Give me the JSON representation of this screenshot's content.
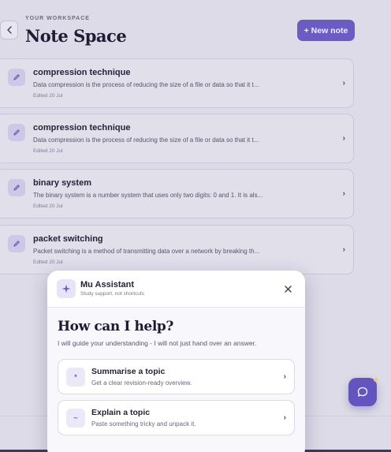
{
  "header": {
    "workspace_label": "YOUR WORKSPACE",
    "title": "Note Space",
    "new_note_label": "+ New note",
    "back_icon": "chevron-left-icon"
  },
  "notes": [
    {
      "title": "compression technique",
      "snippet": "Data compression is the process of reducing the size of a file or data so that it t...",
      "edited": "Edited 20 Jul"
    },
    {
      "title": "compression technique",
      "snippet": "Data compression is the process of reducing the size of a file or data so that it t...",
      "edited": "Edited 20 Jul"
    },
    {
      "title": "binary system",
      "snippet": "The binary system is a number system that uses only two digits: 0 and 1. It is als...",
      "edited": "Edited 20 Jul"
    },
    {
      "title": "packet switching",
      "snippet": "Packet switching is a method of transmitting data over a network by breaking th...",
      "edited": "Edited 20 Jul"
    }
  ],
  "assistant": {
    "name": "Mu Assistant",
    "tagline": "Study support, not shortcuts",
    "heading": "How can I help?",
    "intro": "I will guide your understanding - I will not just hand over an answer.",
    "options": [
      {
        "icon_glyph": "*",
        "title": "Summarise a topic",
        "description": "Get a clear revision-ready overview."
      },
      {
        "icon_glyph": "~",
        "title": "Explain a topic",
        "description": "Paste something tricky and unpack it."
      }
    ]
  },
  "colors": {
    "accent": "#6a5cc4",
    "background": "#dddbe7",
    "panel": "#f8f7fc"
  }
}
